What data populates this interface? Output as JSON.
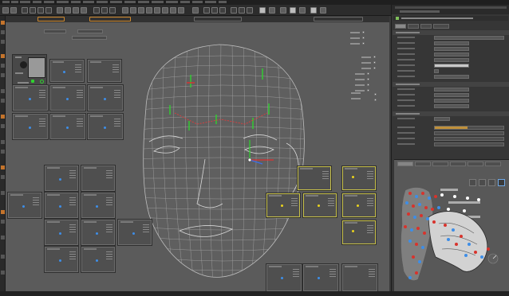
{
  "colors": {
    "app_bg": "#3a3a3a",
    "viewport_bg": "#5b5b5b",
    "panel_bg": "#363636",
    "accent_orange": "#d08a2e",
    "selection_yellow": "#c9c24a",
    "control_blue": "#3d8ee8",
    "control_yellow": "#e8d21e",
    "control_red": "#d8332c",
    "wireframe": "#bdbdbd"
  },
  "icons": {
    "avatar": "face-thumbnail-icon",
    "node": "hierarchy-node-icon",
    "axis": "axis-gizmo-icon",
    "expression": "face-expression-icon"
  },
  "viewport": {
    "camera": "perspective"
  },
  "properties": {
    "tint_amount": 0.48
  },
  "picker": {
    "tab_count": 6
  }
}
